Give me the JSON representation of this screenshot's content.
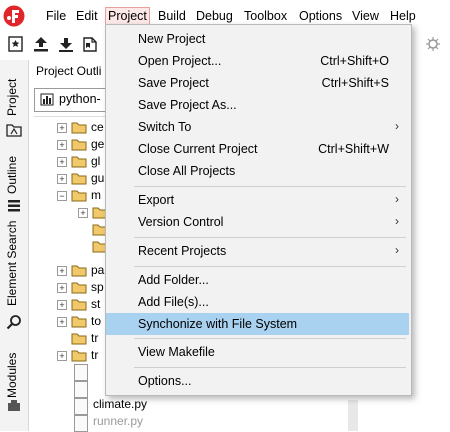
{
  "menubar": {
    "items": [
      "File",
      "Edit",
      "Project",
      "Build",
      "Debug",
      "Toolbox",
      "Options",
      "View",
      "Help"
    ],
    "active_index": 2
  },
  "toolbar": {
    "buttons": [
      "new-project-icon",
      "import-icon",
      "download-icon",
      "bookmark-icon"
    ]
  },
  "side_tabs": [
    "Project",
    "Outline",
    "Element Search",
    "Modules"
  ],
  "panel": {
    "title": "Project Outli",
    "selector_text": "python-"
  },
  "tree": {
    "folders": [
      "ce",
      "ge",
      "gl",
      "gu",
      "m",
      "pa",
      "sp",
      "st",
      "to",
      "tr",
      "tr"
    ],
    "files": [
      "climate.py",
      "runner.py"
    ]
  },
  "dropdown": {
    "items": [
      {
        "label": "New Project",
        "shortcut": "",
        "submenu": false
      },
      {
        "label": "Open Project...",
        "shortcut": "Ctrl+Shift+O",
        "submenu": false
      },
      {
        "label": "Save Project",
        "shortcut": "Ctrl+Shift+S",
        "submenu": false
      },
      {
        "label": "Save Project As...",
        "shortcut": "",
        "submenu": false
      },
      {
        "label": "Switch To",
        "shortcut": "",
        "submenu": true
      },
      {
        "label": "Close Current Project",
        "shortcut": "Ctrl+Shift+W",
        "submenu": false
      },
      {
        "label": "Close All Projects",
        "shortcut": "",
        "submenu": false
      },
      {
        "label": "Export",
        "shortcut": "",
        "submenu": true
      },
      {
        "label": "Version Control",
        "shortcut": "",
        "submenu": true
      },
      {
        "label": "Recent Projects",
        "shortcut": "",
        "submenu": true
      },
      {
        "label": "Add Folder...",
        "shortcut": "",
        "submenu": false
      },
      {
        "label": "Add File(s)...",
        "shortcut": "",
        "submenu": false
      },
      {
        "label": "Synchonize with File System",
        "shortcut": "",
        "submenu": false
      },
      {
        "label": "View Makefile",
        "shortcut": "",
        "submenu": false
      },
      {
        "label": "Options...",
        "shortcut": "",
        "submenu": false
      }
    ],
    "highlighted_index": 12
  },
  "colors": {
    "highlight": "#a9d2f0",
    "active_menu_bg": "#fde8e8",
    "active_menu_border": "#e6a0a0",
    "logo_red": "#e0262b"
  }
}
